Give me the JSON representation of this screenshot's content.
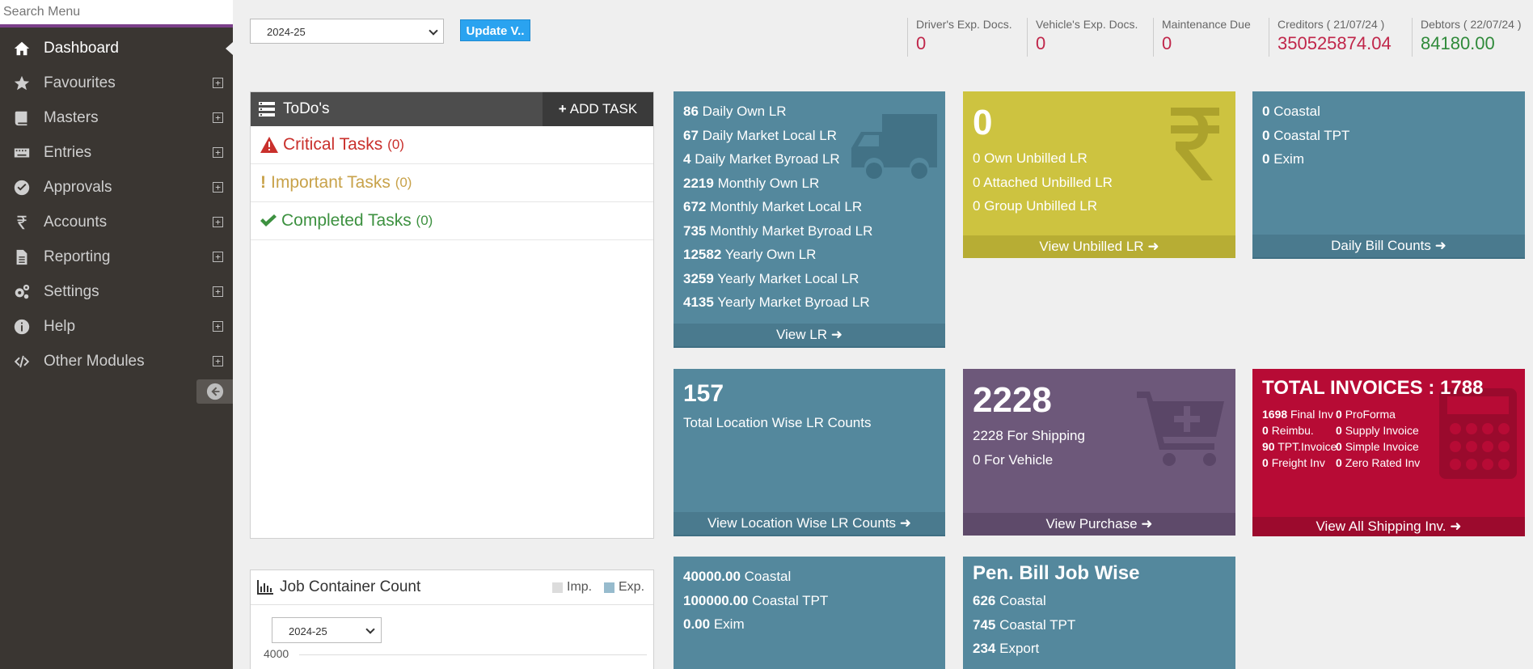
{
  "sidebar": {
    "search_placeholder": "Search Menu",
    "items": [
      {
        "label": "Dashboard",
        "icon": "home-icon"
      },
      {
        "label": "Favourites",
        "icon": "star-icon"
      },
      {
        "label": "Masters",
        "icon": "book-icon"
      },
      {
        "label": "Entries",
        "icon": "keyboard-icon"
      },
      {
        "label": "Approvals",
        "icon": "check-circle-icon"
      },
      {
        "label": "Accounts",
        "icon": "rupee-icon"
      },
      {
        "label": "Reporting",
        "icon": "file-icon"
      },
      {
        "label": "Settings",
        "icon": "gears-icon"
      },
      {
        "label": "Help",
        "icon": "info-icon"
      },
      {
        "label": "Other Modules",
        "icon": "code-icon"
      }
    ],
    "plus_symbol": "+"
  },
  "topbar": {
    "year_value": "2024-25",
    "update_label": "Update V..",
    "stats": [
      {
        "label": "Driver's Exp. Docs.",
        "value": "0"
      },
      {
        "label": "Vehicle's Exp. Docs.",
        "value": "0"
      },
      {
        "label": "Maintenance Due",
        "value": "0"
      },
      {
        "label": "Creditors ( 21/07/24 )",
        "value": "350525874.04"
      },
      {
        "label": "Debtors ( 22/07/24 )",
        "value": "84180.00"
      }
    ]
  },
  "todo": {
    "title": "ToDo's",
    "add_label": "ADD TASK",
    "tasks": [
      {
        "label": "Critical Tasks",
        "count": "(0)",
        "color": "#c9302c"
      },
      {
        "label": "Important Tasks",
        "count": "(0)",
        "color": "#c8a24a"
      },
      {
        "label": "Completed Tasks",
        "count": "(0)",
        "color": "#3d9140"
      }
    ]
  },
  "job_container": {
    "title": "Job Container Count",
    "legend_imp": "Imp.",
    "legend_exp": "Exp.",
    "year_value": "2024-25",
    "axis_top": "4000"
  },
  "cards": {
    "lr": {
      "lines": [
        {
          "num": "86",
          "text": "Daily Own LR"
        },
        {
          "num": "67",
          "text": "Daily Market Local LR"
        },
        {
          "num": "4",
          "text": "Daily Market Byroad LR"
        },
        {
          "num": "2219",
          "text": "Monthly Own LR"
        },
        {
          "num": "672",
          "text": "Monthly Market Local LR"
        },
        {
          "num": "735",
          "text": "Monthly Market Byroad LR"
        },
        {
          "num": "12582",
          "text": "Yearly Own LR"
        },
        {
          "num": "3259",
          "text": "Yearly Market Local LR"
        },
        {
          "num": "4135",
          "text": "Yearly Market Byroad LR"
        }
      ],
      "footer": "View LR"
    },
    "unbilled": {
      "big": "0",
      "lines": [
        "0 Own Unbilled LR",
        "0 Attached Unbilled LR",
        "0 Group Unbilled LR"
      ],
      "footer": "View Unbilled LR"
    },
    "daily_bill": {
      "lines": [
        {
          "num": "0",
          "text": "Coastal"
        },
        {
          "num": "0",
          "text": "Coastal TPT"
        },
        {
          "num": "0",
          "text": "Exim"
        }
      ],
      "footer": "Daily Bill Counts"
    },
    "location": {
      "big": "157",
      "text": "Total Location Wise LR Counts",
      "footer": "View Location Wise LR Counts"
    },
    "purchase": {
      "big": "2228",
      "lines": [
        "2228 For Shipping",
        "0 For Vehicle"
      ],
      "footer": "View Purchase"
    },
    "invoices": {
      "title": "TOTAL INVOICES : 1788",
      "rows": [
        [
          {
            "num": "1698",
            "text": "Final Inv"
          },
          {
            "num": "0",
            "text": "ProForma"
          }
        ],
        [
          {
            "num": "0",
            "text": "Reimbu."
          },
          {
            "num": "0",
            "text": "Supply Invoice"
          }
        ],
        [
          {
            "num": "90",
            "text": "TPT.Invoice"
          },
          {
            "num": "0",
            "text": "Simple Invoice"
          }
        ],
        [
          {
            "num": "0",
            "text": "Freight Inv"
          },
          {
            "num": "0",
            "text": "Zero Rated Inv"
          }
        ]
      ],
      "footer": "View All Shipping Inv."
    },
    "amounts": {
      "lines": [
        {
          "num": "40000.00",
          "text": "Coastal"
        },
        {
          "num": "100000.00",
          "text": "Coastal TPT"
        },
        {
          "num": "0.00",
          "text": "Exim"
        }
      ]
    },
    "pen_bill": {
      "title": "Pen. Bill Job Wise",
      "lines": [
        {
          "num": "626",
          "text": "Coastal"
        },
        {
          "num": "745",
          "text": "Coastal TPT"
        },
        {
          "num": "234",
          "text": "Export"
        }
      ]
    }
  }
}
